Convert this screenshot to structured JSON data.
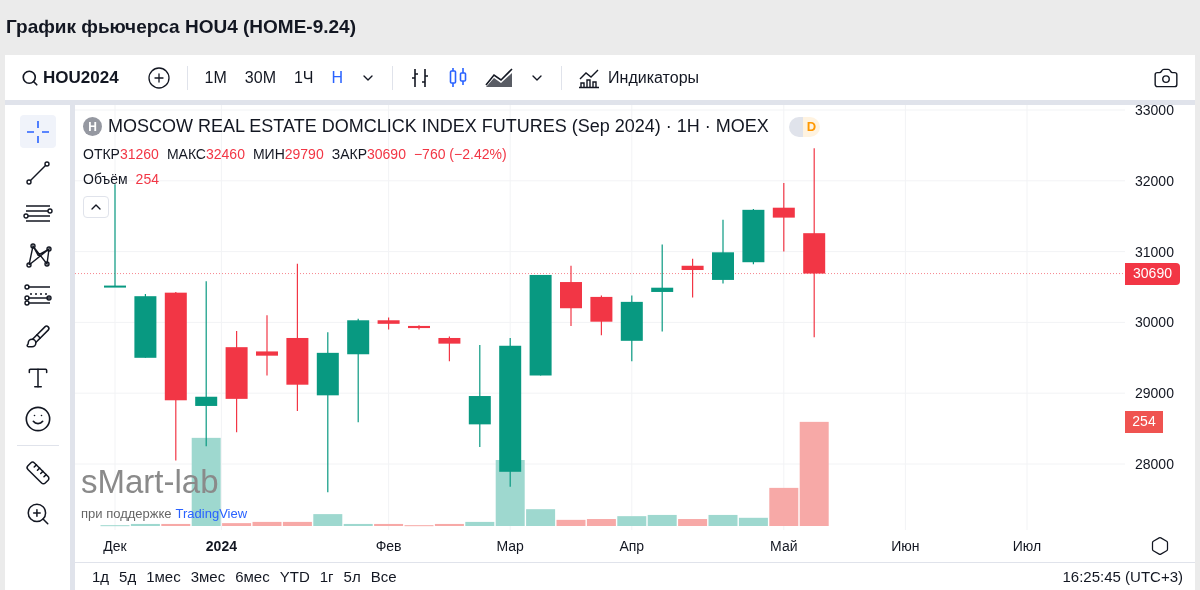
{
  "page_title": "График фьючерса HOU4 (HOME-9.24)",
  "toolbar": {
    "symbol": "HOU2024",
    "intervals": [
      {
        "label": "1М",
        "selected": false
      },
      {
        "label": "30М",
        "selected": false
      },
      {
        "label": "1Ч",
        "selected": false
      },
      {
        "label": "Н",
        "selected": true
      }
    ],
    "chart_types": [
      {
        "kind": "bars",
        "selected": false
      },
      {
        "kind": "candles",
        "selected": true
      },
      {
        "kind": "area",
        "selected": false
      }
    ],
    "indicators": "Индикаторы"
  },
  "sidebar": {
    "tools": [
      {
        "kind": "crosshair",
        "selected": true
      },
      {
        "kind": "line",
        "selected": false
      },
      {
        "kind": "hlines",
        "selected": false
      },
      {
        "kind": "pattern",
        "selected": false
      },
      {
        "kind": "fib",
        "selected": false
      },
      {
        "kind": "brush",
        "selected": false
      },
      {
        "kind": "text",
        "selected": false
      },
      {
        "kind": "emoji",
        "selected": false
      }
    ],
    "measure_tools": [
      {
        "kind": "ruler",
        "selected": false
      },
      {
        "kind": "zoom",
        "selected": false
      }
    ]
  },
  "legend": {
    "symbol_badge": "H",
    "title": "MOSCOW REAL ESTATE DOMCLICK INDEX FUTURES (Sep 2024) · 1H · MOEX",
    "status_badge": "D",
    "ohlc": [
      {
        "label": "ОТКР",
        "value": "31260"
      },
      {
        "label": "МАКС",
        "value": "32460"
      },
      {
        "label": "МИН",
        "value": "29790"
      },
      {
        "label": "ЗАКР",
        "value": "30690"
      }
    ],
    "change": "−760 (−2.42%)",
    "volume_label": "Объём",
    "volume_value": "254"
  },
  "watermark": {
    "brand": "sMart-lab",
    "support": "при поддержке",
    "partner": "TradingView"
  },
  "price_axis": [
    "33000",
    "32000",
    "31000",
    "30000",
    "29000",
    "28000"
  ],
  "time_axis": [
    {
      "label": "Дек",
      "kind": "month"
    },
    {
      "label": "2024",
      "kind": "year"
    },
    {
      "label": "Фев",
      "kind": "month"
    },
    {
      "label": "Мар",
      "kind": "month"
    },
    {
      "label": "Апр",
      "kind": "month"
    },
    {
      "label": "Май",
      "kind": "month"
    },
    {
      "label": "Июн",
      "kind": "month"
    },
    {
      "label": "Июл",
      "kind": "month"
    }
  ],
  "last_price": "30690",
  "last_volume": "254",
  "ranges": [
    "1д",
    "5д",
    "1мес",
    "3мес",
    "6мес",
    "YTD",
    "1г",
    "5л",
    "Все"
  ],
  "time": "16:25:45 (UTC+3)"
}
